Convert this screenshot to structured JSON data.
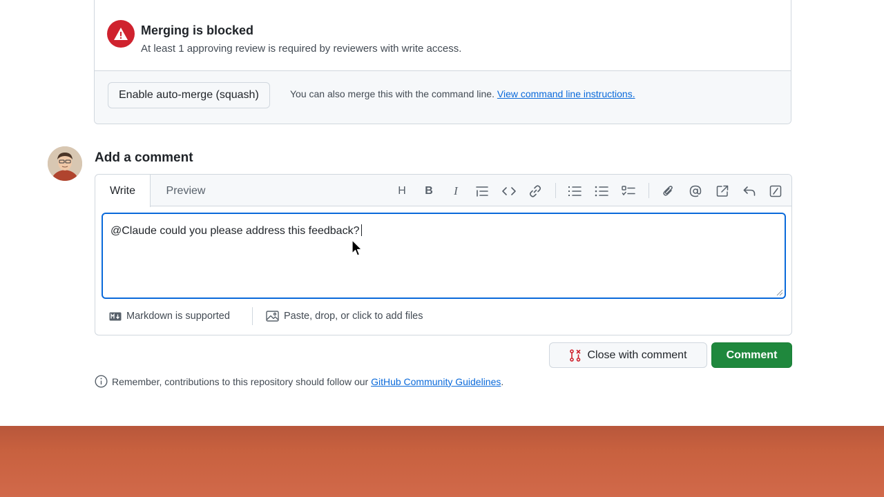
{
  "merge": {
    "title": "Merging is blocked",
    "subtitle": "At least 1 approving review is required by reviewers with write access.",
    "auto_merge_label": "Enable auto-merge (squash)",
    "cmd_text": "You can also merge this with the command line.",
    "cmd_link": "View command line instructions."
  },
  "comment": {
    "heading": "Add a comment",
    "tabs": [
      {
        "label": "Write",
        "active": true
      },
      {
        "label": "Preview",
        "active": false
      }
    ],
    "toolbar_icons": [
      "heading-icon",
      "bold-icon",
      "italic-icon",
      "quote-icon",
      "code-icon",
      "link-icon",
      "numbered-list-icon",
      "bulleted-list-icon",
      "task-list-icon",
      "attach-icon",
      "mention-icon",
      "cross-reference-icon",
      "reply-icon",
      "slash-command-icon"
    ],
    "toolbar_glyphs": {
      "heading": "H",
      "bold": "B",
      "italic": "I"
    },
    "text": "@Claude could you please address this feedback?",
    "markdown_label": "Markdown is supported",
    "files_label": "Paste, drop, or click to add files"
  },
  "actions": {
    "close_label": "Close with comment",
    "comment_label": "Comment"
  },
  "guidelines": {
    "text": "Remember, contributions to this repository should follow our",
    "link": "GitHub Community Guidelines",
    "suffix": "."
  },
  "colors": {
    "danger": "#cf222e",
    "primary": "#1f883d",
    "link": "#0969da",
    "focus": "#0969da",
    "band": "#c8613f"
  }
}
